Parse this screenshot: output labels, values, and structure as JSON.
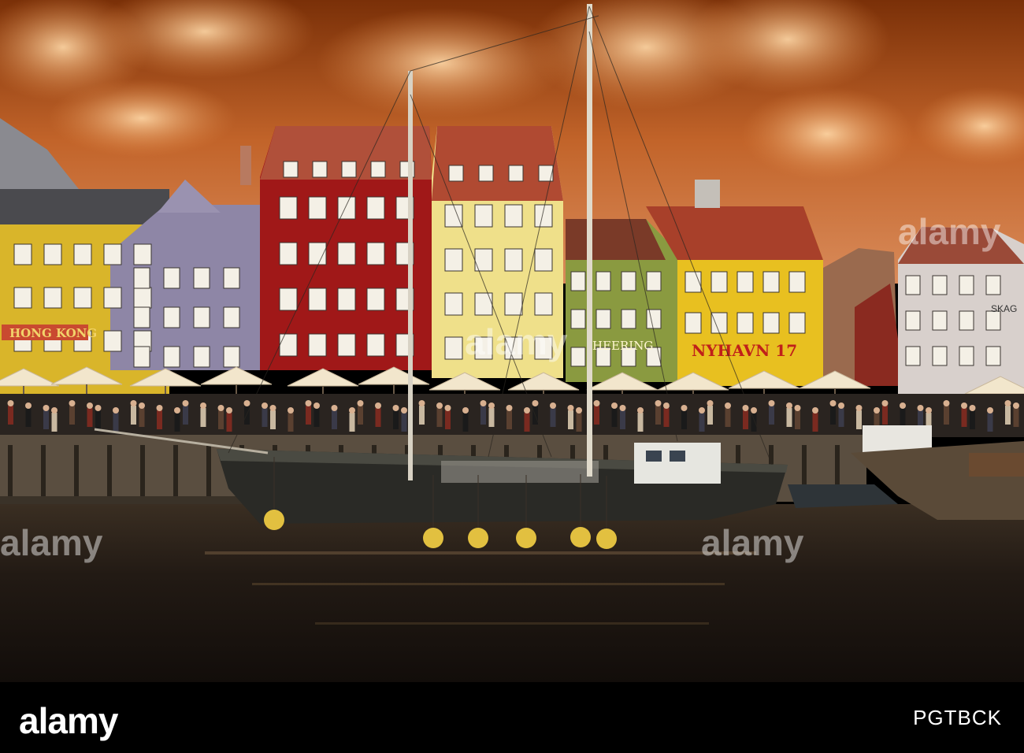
{
  "photo": {
    "signs": {
      "hong_kong": "HONG KONG",
      "heering": "HEERING",
      "nyhavn": "NYHAVN 17",
      "skag": "SKAG"
    },
    "watermarks": [
      "alamy",
      "alamy",
      "alamy",
      "alamy"
    ]
  },
  "footer": {
    "logo": "alamy",
    "image_id": "PGTBCK"
  },
  "colors": {
    "sky_top": "#8a3d10",
    "sky_glow": "#f0a060",
    "water": "#1c1510",
    "red_house": "#a01818",
    "yellow_house": "#e8c020",
    "green_house": "#8a9a40",
    "purple_house": "#8e86a6",
    "hull": "#2a2a26",
    "buoy": "#e2c040"
  }
}
